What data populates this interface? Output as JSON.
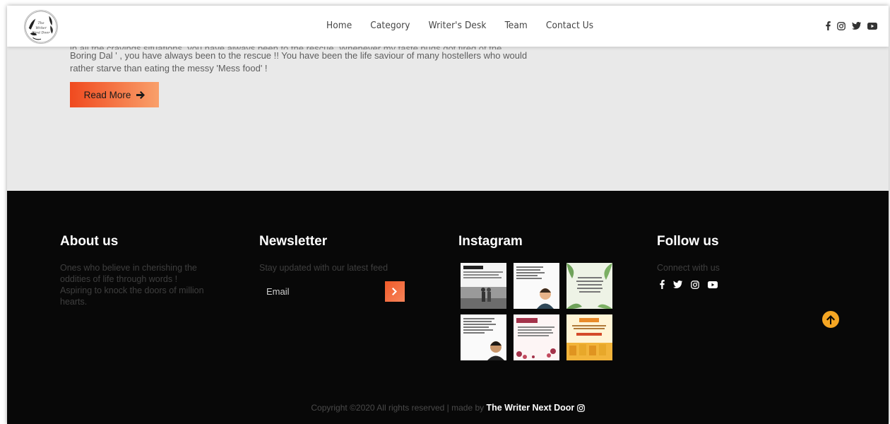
{
  "header": {
    "logo_text": [
      "The",
      "Writer",
      "Next Door"
    ],
    "nav": [
      "Home",
      "Category",
      "Writer's Desk",
      "Team",
      "Contact Us"
    ],
    "social_icons": [
      "facebook-icon",
      "instagram-icon",
      "twitter-icon",
      "youtube-icon"
    ]
  },
  "article": {
    "cut_line": "in all the cravings situations, you have always been to the rescue. Whenever my taste buds got tired of the",
    "line1": "Boring Dal ' , you have always been to the rescue !! You have been the life saviour of many hostellers who would",
    "line2": "rather starve than eating the messy 'Mess food' !",
    "read_more": "Read More"
  },
  "footer": {
    "about": {
      "title": "About us",
      "lines": [
        "Ones who believe in cherishing the",
        "oddities of life through words !",
        "Aspiring to knock the doors of million",
        "hearts."
      ]
    },
    "newsletter": {
      "title": "Newsletter",
      "subtitle": "Stay updated with our latest feed",
      "email_placeholder": "Email"
    },
    "instagram": {
      "title": "Instagram",
      "posts": [
        "post-1",
        "post-2",
        "post-3",
        "post-4",
        "post-5",
        "post-6"
      ]
    },
    "follow": {
      "title": "Follow us",
      "subtitle": "Connect with us",
      "icons": [
        "facebook-icon",
        "twitter-icon",
        "instagram-icon",
        "youtube-icon"
      ]
    },
    "copyright": {
      "text": "Copyright ©2020 All rights reserved | made by",
      "brand": "The Writer Next Door"
    }
  },
  "colors": {
    "accent_start": "#f04a1f",
    "accent_end": "#f9a06b",
    "footer_bg": "#080808",
    "body_bg": "#e9e9e9",
    "to_top": "#f5a623"
  }
}
